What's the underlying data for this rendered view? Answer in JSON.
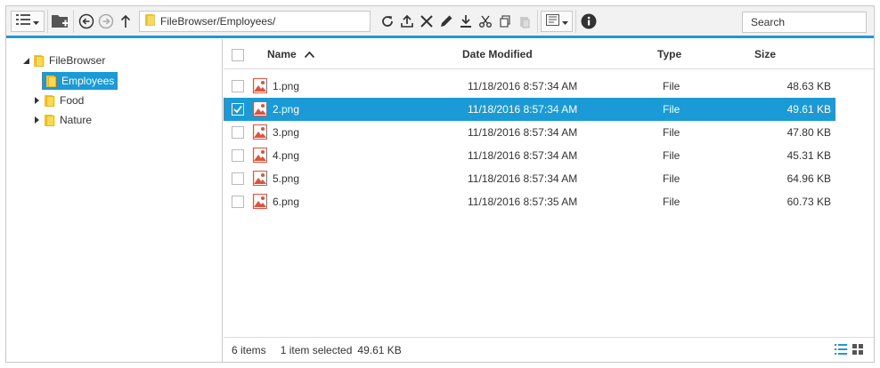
{
  "toolbar": {
    "address_path": "FileBrowser/Employees/",
    "search_placeholder": "Search"
  },
  "tree": {
    "root": "FileBrowser",
    "children": [
      {
        "label": "Employees",
        "selected": true,
        "expandable": false
      },
      {
        "label": "Food",
        "selected": false,
        "expandable": true
      },
      {
        "label": "Nature",
        "selected": false,
        "expandable": true
      }
    ]
  },
  "grid": {
    "columns": [
      "Name",
      "Date Modified",
      "Type",
      "Size"
    ],
    "sort_column": "Name",
    "sort_direction": "ascending",
    "rows": [
      {
        "name": "1.png",
        "date": "11/18/2016 8:57:34 AM",
        "type": "File",
        "size": "48.63 KB",
        "selected": false
      },
      {
        "name": "2.png",
        "date": "11/18/2016 8:57:34 AM",
        "type": "File",
        "size": "49.61 KB",
        "selected": true
      },
      {
        "name": "3.png",
        "date": "11/18/2016 8:57:34 AM",
        "type": "File",
        "size": "47.80 KB",
        "selected": false
      },
      {
        "name": "4.png",
        "date": "11/18/2016 8:57:34 AM",
        "type": "File",
        "size": "45.31 KB",
        "selected": false
      },
      {
        "name": "5.png",
        "date": "11/18/2016 8:57:34 AM",
        "type": "File",
        "size": "64.96 KB",
        "selected": false
      },
      {
        "name": "6.png",
        "date": "11/18/2016 8:57:35 AM",
        "type": "File",
        "size": "60.73 KB",
        "selected": false
      }
    ]
  },
  "status": {
    "item_count": "6 items",
    "selection": "1 item selected",
    "selection_size": "49.61 KB"
  },
  "colors": {
    "accent": "#1a9bd7",
    "folder": "#f4c430",
    "image_icon": "#e0523b"
  }
}
